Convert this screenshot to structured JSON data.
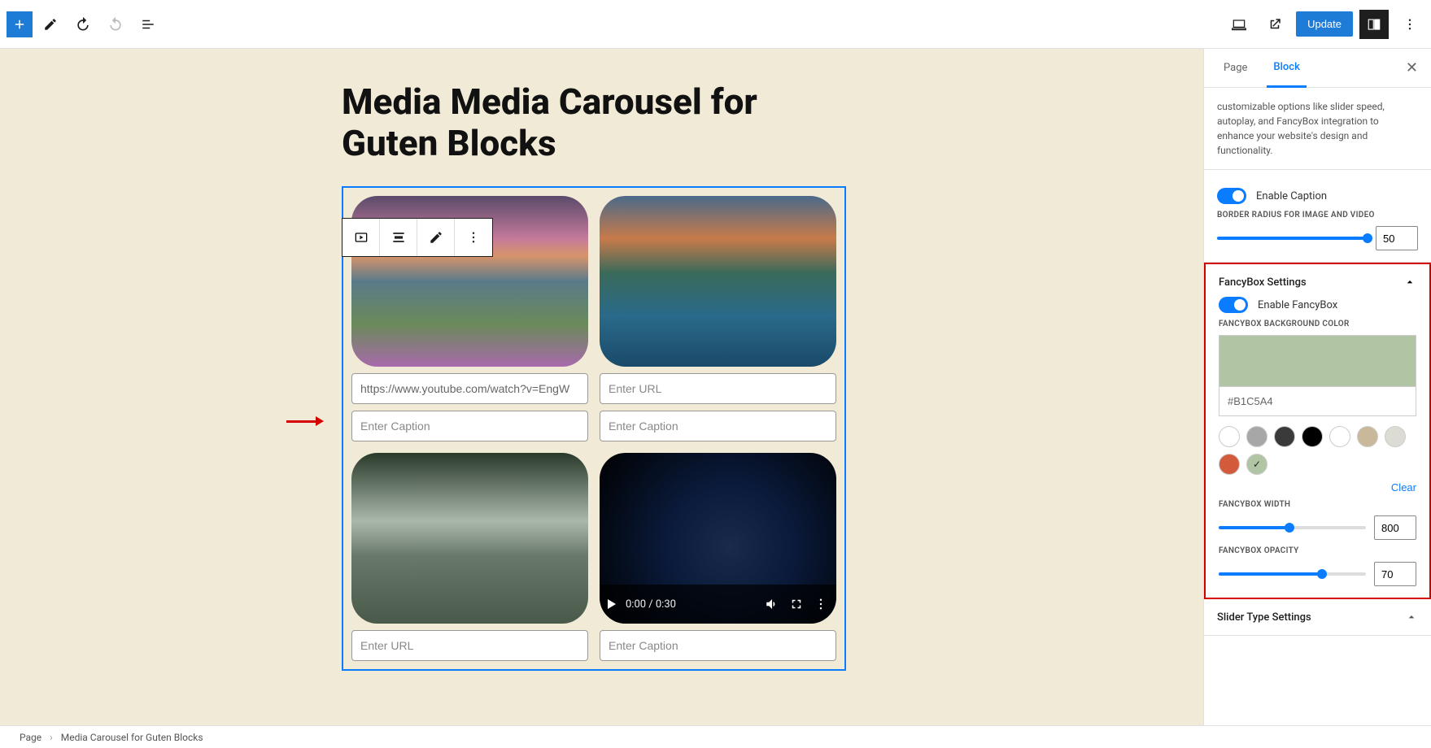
{
  "toolbar": {
    "update_label": "Update"
  },
  "page": {
    "title": "Media Media Carousel for Guten Blocks"
  },
  "block": {
    "cell1_url": "https://www.youtube.com/watch?v=EngW",
    "enter_url": "Enter URL",
    "enter_caption": "Enter Caption",
    "video_time": "0:00 / 0:30"
  },
  "sidebar": {
    "tab_page": "Page",
    "tab_block": "Block",
    "description": "customizable options like slider speed, autoplay, and FancyBox integration to enhance your website's design and functionality.",
    "enable_caption": "Enable Caption",
    "border_radius_label": "BORDER RADIUS FOR IMAGE AND VIDEO",
    "border_radius_value": "50",
    "fancybox": {
      "title": "FancyBox Settings",
      "enable": "Enable FancyBox",
      "bg_label": "FANCYBOX BACKGROUND COLOR",
      "bg_hex": "#B1C5A4",
      "clear": "Clear",
      "width_label": "FANCYBOX WIDTH",
      "width_value": "800",
      "opacity_label": "FANCYBOX OPACITY",
      "opacity_value": "70"
    },
    "slider_type": "Slider Type Settings",
    "swatches": [
      "#ffffff",
      "#a7a7a7",
      "#3a3a3a",
      "#000000",
      "#ffffff",
      "#c9b89a",
      "#dcdcd4",
      "#d35a3a",
      "#B1C5A4"
    ]
  },
  "breadcrumb": {
    "root": "Page",
    "current": "Media Carousel for Guten Blocks"
  }
}
